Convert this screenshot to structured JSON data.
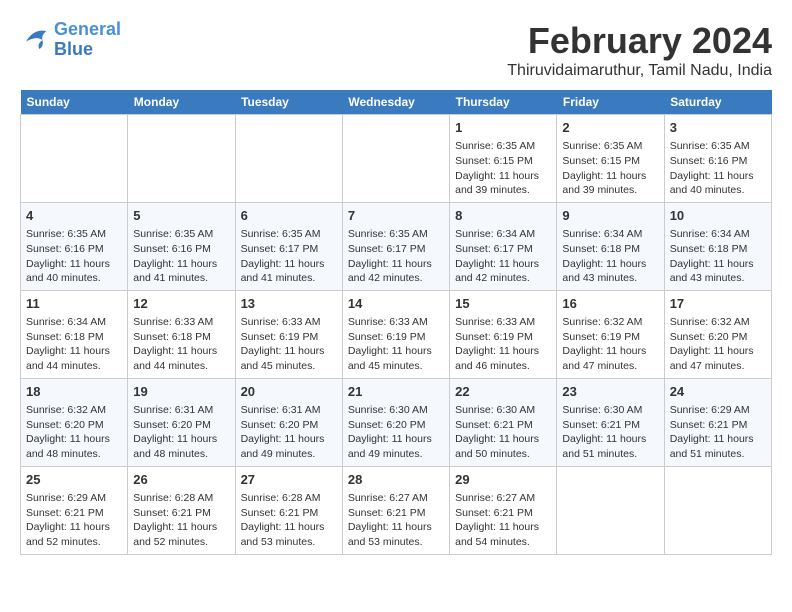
{
  "logo": {
    "line1": "General",
    "line2": "Blue"
  },
  "title": "February 2024",
  "location": "Thiruvidaimaruthur, Tamil Nadu, India",
  "weekdays": [
    "Sunday",
    "Monday",
    "Tuesday",
    "Wednesday",
    "Thursday",
    "Friday",
    "Saturday"
  ],
  "weeks": [
    [
      {
        "day": "",
        "info": ""
      },
      {
        "day": "",
        "info": ""
      },
      {
        "day": "",
        "info": ""
      },
      {
        "day": "",
        "info": ""
      },
      {
        "day": "1",
        "info": "Sunrise: 6:35 AM\nSunset: 6:15 PM\nDaylight: 11 hours\nand 39 minutes."
      },
      {
        "day": "2",
        "info": "Sunrise: 6:35 AM\nSunset: 6:15 PM\nDaylight: 11 hours\nand 39 minutes."
      },
      {
        "day": "3",
        "info": "Sunrise: 6:35 AM\nSunset: 6:16 PM\nDaylight: 11 hours\nand 40 minutes."
      }
    ],
    [
      {
        "day": "4",
        "info": "Sunrise: 6:35 AM\nSunset: 6:16 PM\nDaylight: 11 hours\nand 40 minutes."
      },
      {
        "day": "5",
        "info": "Sunrise: 6:35 AM\nSunset: 6:16 PM\nDaylight: 11 hours\nand 41 minutes."
      },
      {
        "day": "6",
        "info": "Sunrise: 6:35 AM\nSunset: 6:17 PM\nDaylight: 11 hours\nand 41 minutes."
      },
      {
        "day": "7",
        "info": "Sunrise: 6:35 AM\nSunset: 6:17 PM\nDaylight: 11 hours\nand 42 minutes."
      },
      {
        "day": "8",
        "info": "Sunrise: 6:34 AM\nSunset: 6:17 PM\nDaylight: 11 hours\nand 42 minutes."
      },
      {
        "day": "9",
        "info": "Sunrise: 6:34 AM\nSunset: 6:18 PM\nDaylight: 11 hours\nand 43 minutes."
      },
      {
        "day": "10",
        "info": "Sunrise: 6:34 AM\nSunset: 6:18 PM\nDaylight: 11 hours\nand 43 minutes."
      }
    ],
    [
      {
        "day": "11",
        "info": "Sunrise: 6:34 AM\nSunset: 6:18 PM\nDaylight: 11 hours\nand 44 minutes."
      },
      {
        "day": "12",
        "info": "Sunrise: 6:33 AM\nSunset: 6:18 PM\nDaylight: 11 hours\nand 44 minutes."
      },
      {
        "day": "13",
        "info": "Sunrise: 6:33 AM\nSunset: 6:19 PM\nDaylight: 11 hours\nand 45 minutes."
      },
      {
        "day": "14",
        "info": "Sunrise: 6:33 AM\nSunset: 6:19 PM\nDaylight: 11 hours\nand 45 minutes."
      },
      {
        "day": "15",
        "info": "Sunrise: 6:33 AM\nSunset: 6:19 PM\nDaylight: 11 hours\nand 46 minutes."
      },
      {
        "day": "16",
        "info": "Sunrise: 6:32 AM\nSunset: 6:19 PM\nDaylight: 11 hours\nand 47 minutes."
      },
      {
        "day": "17",
        "info": "Sunrise: 6:32 AM\nSunset: 6:20 PM\nDaylight: 11 hours\nand 47 minutes."
      }
    ],
    [
      {
        "day": "18",
        "info": "Sunrise: 6:32 AM\nSunset: 6:20 PM\nDaylight: 11 hours\nand 48 minutes."
      },
      {
        "day": "19",
        "info": "Sunrise: 6:31 AM\nSunset: 6:20 PM\nDaylight: 11 hours\nand 48 minutes."
      },
      {
        "day": "20",
        "info": "Sunrise: 6:31 AM\nSunset: 6:20 PM\nDaylight: 11 hours\nand 49 minutes."
      },
      {
        "day": "21",
        "info": "Sunrise: 6:30 AM\nSunset: 6:20 PM\nDaylight: 11 hours\nand 49 minutes."
      },
      {
        "day": "22",
        "info": "Sunrise: 6:30 AM\nSunset: 6:21 PM\nDaylight: 11 hours\nand 50 minutes."
      },
      {
        "day": "23",
        "info": "Sunrise: 6:30 AM\nSunset: 6:21 PM\nDaylight: 11 hours\nand 51 minutes."
      },
      {
        "day": "24",
        "info": "Sunrise: 6:29 AM\nSunset: 6:21 PM\nDaylight: 11 hours\nand 51 minutes."
      }
    ],
    [
      {
        "day": "25",
        "info": "Sunrise: 6:29 AM\nSunset: 6:21 PM\nDaylight: 11 hours\nand 52 minutes."
      },
      {
        "day": "26",
        "info": "Sunrise: 6:28 AM\nSunset: 6:21 PM\nDaylight: 11 hours\nand 52 minutes."
      },
      {
        "day": "27",
        "info": "Sunrise: 6:28 AM\nSunset: 6:21 PM\nDaylight: 11 hours\nand 53 minutes."
      },
      {
        "day": "28",
        "info": "Sunrise: 6:27 AM\nSunset: 6:21 PM\nDaylight: 11 hours\nand 53 minutes."
      },
      {
        "day": "29",
        "info": "Sunrise: 6:27 AM\nSunset: 6:21 PM\nDaylight: 11 hours\nand 54 minutes."
      },
      {
        "day": "",
        "info": ""
      },
      {
        "day": "",
        "info": ""
      }
    ]
  ]
}
